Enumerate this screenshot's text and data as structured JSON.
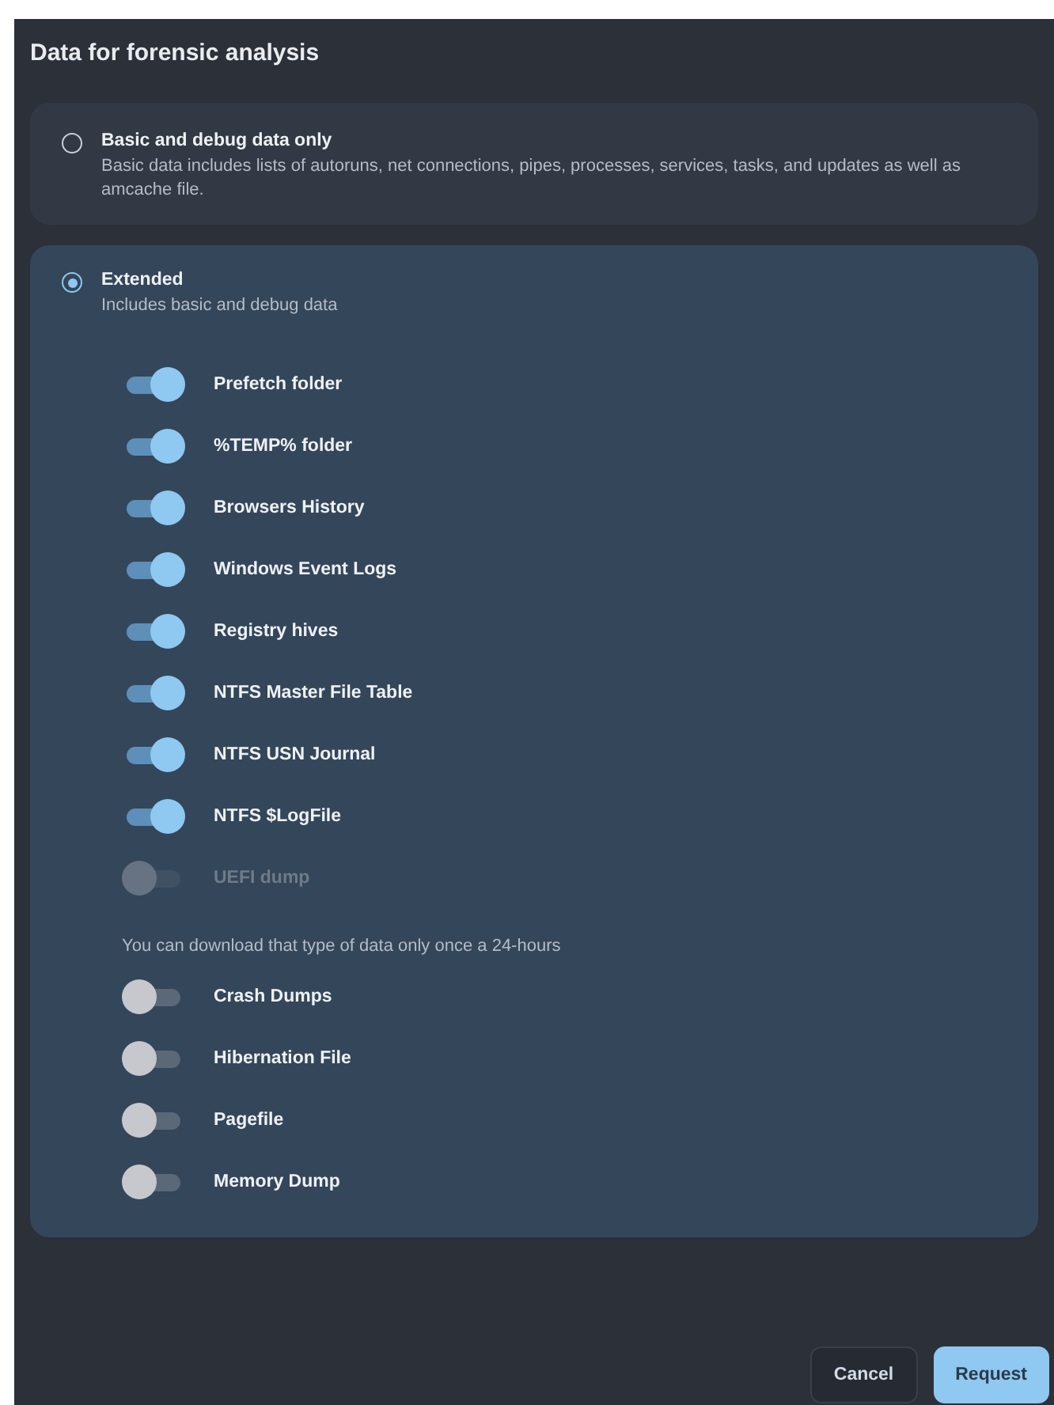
{
  "dialog": {
    "title": "Data for forensic analysis"
  },
  "options": [
    {
      "label": "Basic and debug data only",
      "description": "Basic data includes lists of autoruns, net connections, pipes, processes, services, tasks, and updates as well as amcache file.",
      "selected": false
    },
    {
      "label": "Extended",
      "description": "Includes basic and debug data",
      "selected": true
    }
  ],
  "toggles": [
    {
      "label": "Prefetch folder",
      "on": true,
      "disabled": false
    },
    {
      "label": "%TEMP% folder",
      "on": true,
      "disabled": false
    },
    {
      "label": "Browsers History",
      "on": true,
      "disabled": false
    },
    {
      "label": "Windows Event Logs",
      "on": true,
      "disabled": false
    },
    {
      "label": "Registry hives",
      "on": true,
      "disabled": false
    },
    {
      "label": "NTFS Master File Table",
      "on": true,
      "disabled": false
    },
    {
      "label": "NTFS USN Journal",
      "on": true,
      "disabled": false
    },
    {
      "label": "NTFS $LogFile",
      "on": true,
      "disabled": false
    },
    {
      "label": "UEFI dump",
      "on": false,
      "disabled": true
    }
  ],
  "limited_note": "You can download that type of data only once a 24-hours",
  "limited_toggles": [
    {
      "label": "Crash Dumps",
      "on": false,
      "disabled": false
    },
    {
      "label": "Hibernation File",
      "on": false,
      "disabled": false
    },
    {
      "label": "Pagefile",
      "on": false,
      "disabled": false
    },
    {
      "label": "Memory Dump",
      "on": false,
      "disabled": false
    }
  ],
  "buttons": [
    {
      "label": "Cancel",
      "kind": "secondary"
    },
    {
      "label": "Request",
      "kind": "primary"
    }
  ]
}
